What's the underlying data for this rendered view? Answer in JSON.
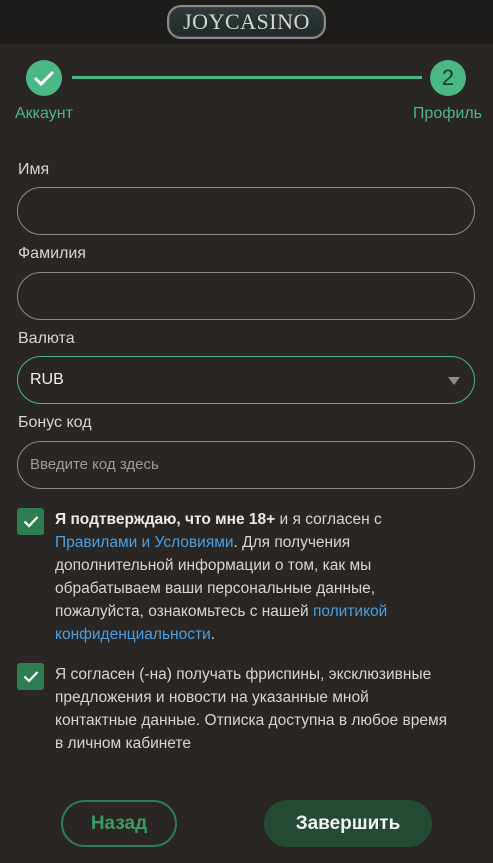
{
  "header": {
    "logo_text": "JOYCASINO"
  },
  "stepper": {
    "step1": {
      "label": "Аккаунт",
      "icon": "check-icon"
    },
    "step2": {
      "number": "2",
      "label": "Профиль"
    }
  },
  "form": {
    "first_name": {
      "label": "Имя",
      "value": ""
    },
    "last_name": {
      "label": "Фамилия",
      "value": ""
    },
    "currency": {
      "label": "Валюта",
      "value": "RUB"
    },
    "bonus": {
      "label": "Бонус код",
      "placeholder": "Введите код здесь",
      "value": ""
    }
  },
  "consents": {
    "terms": {
      "bold": "Я подтверждаю, что мне 18+",
      "text1": " и я согласен с ",
      "link1": "Правилами и Условиями",
      "text2": ". Для получения дополнительной информации о том, как мы обрабатываем ваши персональные данные, пожалуйста, ознакомьтесь с нашей ",
      "link2": "политикой конфиденциальности",
      "text3": ".",
      "checked": true
    },
    "marketing": {
      "text": "Я согласен (-на) получать фриспины, эксклюзивные предложения и новости на указанные мной контактные данные. Отписка доступна в любое время в личном кабинете",
      "checked": true
    }
  },
  "buttons": {
    "back": "Назад",
    "finish": "Завершить"
  },
  "colors": {
    "accent": "#4ab885",
    "checkbox": "#2e7d52",
    "link": "#4b9fe0",
    "background": "#2a2624"
  }
}
